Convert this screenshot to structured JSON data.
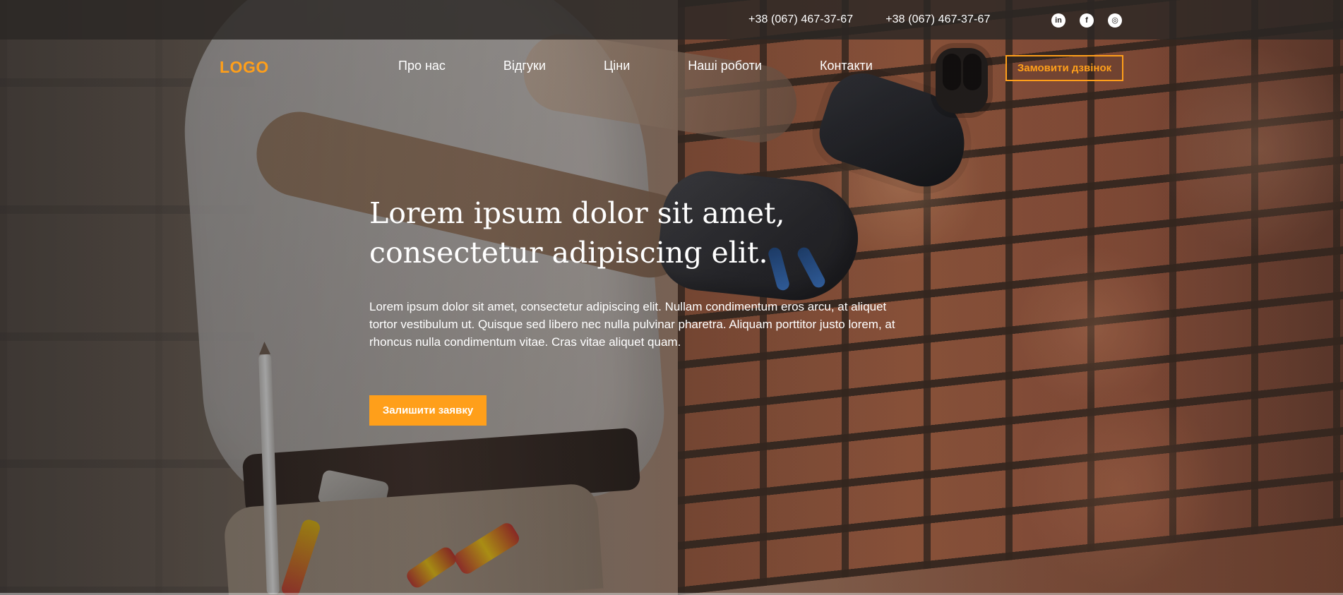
{
  "topbar": {
    "phones": [
      "+38 (067) 467-37-67",
      "+38 (067) 467-37-67"
    ],
    "socials": [
      {
        "icon": "linkedin-icon",
        "glyph": "in"
      },
      {
        "icon": "facebook-icon",
        "glyph": "f"
      },
      {
        "icon": "instagram-icon",
        "glyph": "◎"
      }
    ]
  },
  "header": {
    "logo": "LOGO",
    "nav": [
      "Про нас",
      "Відгуки",
      "Ціни",
      "Наші роботи",
      "Контакти"
    ],
    "call_button": "Замовити дзвінок"
  },
  "hero": {
    "title": "Lorem ipsum dolor sit amet, consectetur adipiscing elit.",
    "text": "Lorem ipsum dolor sit amet, consectetur adipiscing elit. Nullam condimentum eros arcu, at aliquet tortor vestibulum ut. Quisque sed libero nec nulla pulvinar pharetra. Aliquam porttitor justo lorem, at rhoncus nulla condimentum vitae. Cras vitae aliquet quam.",
    "cta_button": "Залишити заявку"
  },
  "colors": {
    "accent": "#ff9f1a",
    "text": "#ffffff",
    "topbar": "#2b2725"
  }
}
